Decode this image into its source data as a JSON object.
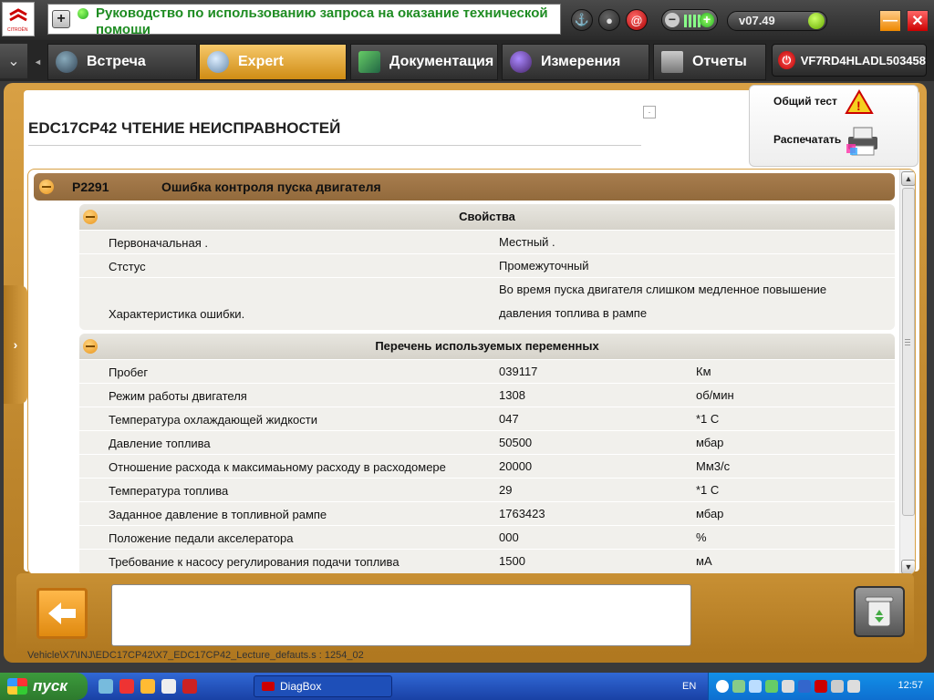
{
  "app": {
    "title": "Руководство по использованию запроса на оказание технической помощи",
    "version": "v07.49",
    "vin": "VF7RD4HLADL503458"
  },
  "tabs": [
    {
      "label": "Встреча",
      "active": false
    },
    {
      "label": "Expert",
      "active": true
    },
    {
      "label": "Документация",
      "active": false
    },
    {
      "label": "Измерения",
      "active": false
    },
    {
      "label": "Отчеты",
      "active": false
    }
  ],
  "page": {
    "title": "EDC17CP42  ЧТЕНИЕ НЕИСПРАВНОСТЕЙ",
    "actions": {
      "general_test": "Общий тест",
      "print": "Распечатать"
    }
  },
  "fault": {
    "code": "P2291",
    "description": "Ошибка контроля пуска двигателя"
  },
  "properties": {
    "header": "Свойства",
    "rows": [
      {
        "name": "Первоначальная .",
        "value": "Местный ."
      },
      {
        "name": "Стстус",
        "value": "Промежуточный"
      },
      {
        "name": "Характеристика ошибки.",
        "value": "Во время пуска двигателя слишком медленное повышение давления топлива в рампе"
      }
    ]
  },
  "variables": {
    "header": "Перечень используемых переменных",
    "rows": [
      {
        "name": "Пробег",
        "value": "039117",
        "unit": "Км"
      },
      {
        "name": "Режим работы двигателя",
        "value": "1308",
        "unit": "об/мин"
      },
      {
        "name": "Температура охлаждающей жидкости",
        "value": "047",
        "unit": "*1 С"
      },
      {
        "name": "Давление топлива",
        "value": "50500",
        "unit": "мбар"
      },
      {
        "name": "Отношение расхода к максимаьному расходу в расходомере",
        "value": "20000",
        "unit": "Мм3/с"
      },
      {
        "name": "Температура топлива",
        "value": "29",
        "unit": "*1 С"
      },
      {
        "name": "Заданное давление в топливной рампе",
        "value": "1763423",
        "unit": "мбар"
      },
      {
        "name": "Положение педали акселератора",
        "value": "000",
        "unit": "%"
      },
      {
        "name": "Требование к насосу регулирования подачи топлива",
        "value": "1500",
        "unit": "мА"
      }
    ]
  },
  "status_path": "Vehicle\\X7\\INJ\\EDC17CP42\\X7_EDC17CP42_Lecture_defauts.s : 1254_02",
  "taskbar": {
    "start": "пуск",
    "task": "DiagBox",
    "lang": "EN",
    "clock": "12:57"
  }
}
